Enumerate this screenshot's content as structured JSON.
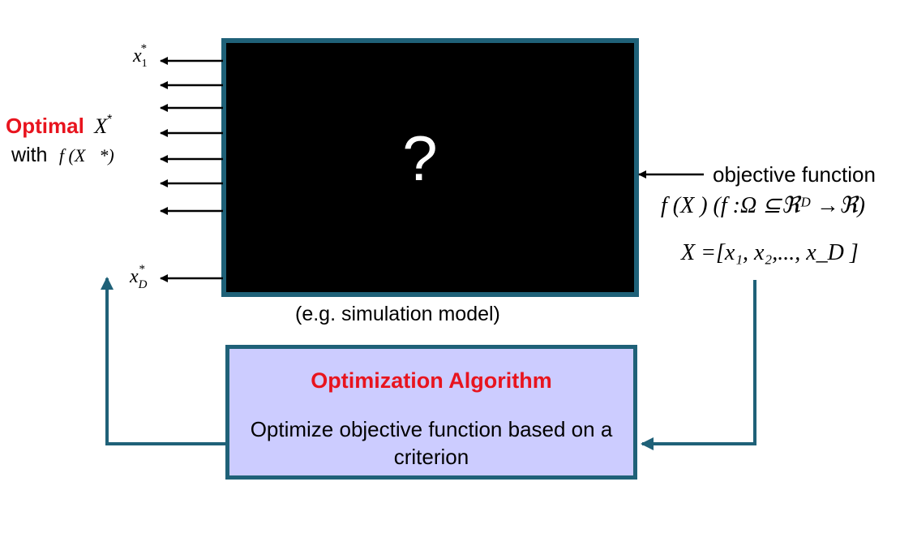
{
  "black_box": {
    "symbol": "?",
    "caption": "(e.g. simulation model)"
  },
  "outputs": {
    "first_label": "x",
    "first_sub": "1",
    "first_sup": "*",
    "last_label": "x",
    "last_sub": "D",
    "last_sup": "*"
  },
  "optimal": {
    "word": "Optimal",
    "symbol": "X",
    "symbol_sup": "*",
    "with_word": "with",
    "with_expr": "f (X⃗*)"
  },
  "objective": {
    "label": "objective function",
    "formula": "f (X ) (f :Ω ⊆ℜᴰ →ℜ)",
    "vector": "X =[x₁, x₂,..., x_D ]"
  },
  "algorithm": {
    "title": "Optimization Algorithm",
    "description": "Optimize objective function based on a criterion"
  },
  "colors": {
    "accent_red": "#e8141e",
    "box_border": "#1f6178",
    "algo_fill": "#ccccff",
    "black_box_fill": "#000000"
  }
}
